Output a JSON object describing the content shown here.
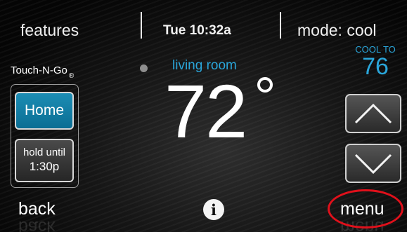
{
  "top_bar": {
    "features_label": "features",
    "datetime": "Tue 10:32a",
    "mode_label": "mode: cool"
  },
  "logo": {
    "text": "Touch-N-Go",
    "registered_mark": "®"
  },
  "left_panel": {
    "home_label": "Home",
    "hold_line1": "hold until",
    "hold_line2": "1:30p"
  },
  "zone": {
    "room_name": "living room",
    "current_temp": "72"
  },
  "setpoint": {
    "label": "COOL TO",
    "value": "76"
  },
  "bottom_bar": {
    "back_label": "back",
    "info_label": "i",
    "menu_label": "menu"
  },
  "colors": {
    "accent_blue": "#2aa6da",
    "home_button": "#1c8db4",
    "highlight_red": "#e0101b"
  },
  "icons": {
    "up": "chevron-up-icon",
    "down": "chevron-down-icon",
    "info": "info-icon",
    "status": "status-dot-icon"
  }
}
